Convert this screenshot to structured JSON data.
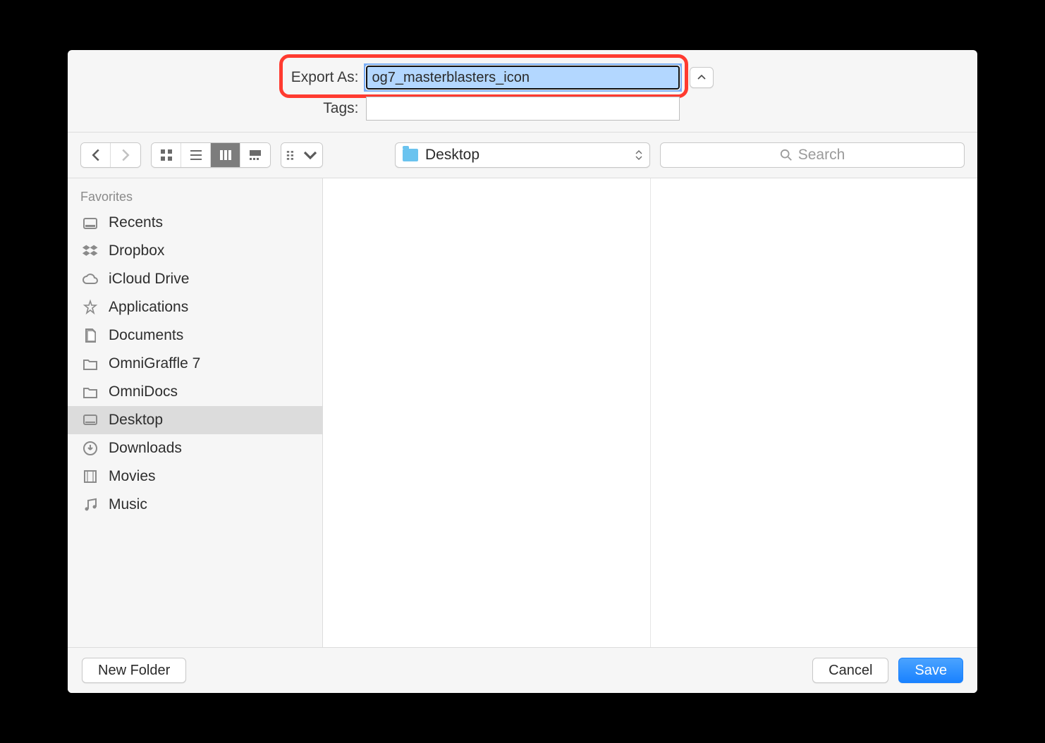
{
  "header": {
    "export_label": "Export As:",
    "export_value": "og7_masterblasters_icon",
    "tags_label": "Tags:",
    "tags_value": ""
  },
  "toolbar": {
    "location_label": "Desktop",
    "search_placeholder": "Search"
  },
  "sidebar": {
    "heading": "Favorites",
    "items": [
      {
        "label": "Recents",
        "icon": "recents-icon",
        "selected": false
      },
      {
        "label": "Dropbox",
        "icon": "dropbox-icon",
        "selected": false
      },
      {
        "label": "iCloud Drive",
        "icon": "cloud-icon",
        "selected": false
      },
      {
        "label": "Applications",
        "icon": "applications-icon",
        "selected": false
      },
      {
        "label": "Documents",
        "icon": "documents-icon",
        "selected": false
      },
      {
        "label": "OmniGraffle 7",
        "icon": "folder-icon",
        "selected": false
      },
      {
        "label": "OmniDocs",
        "icon": "folder-icon",
        "selected": false
      },
      {
        "label": "Desktop",
        "icon": "desktop-icon",
        "selected": true
      },
      {
        "label": "Downloads",
        "icon": "downloads-icon",
        "selected": false
      },
      {
        "label": "Movies",
        "icon": "movies-icon",
        "selected": false
      },
      {
        "label": "Music",
        "icon": "music-icon",
        "selected": false
      }
    ]
  },
  "footer": {
    "new_folder_label": "New Folder",
    "cancel_label": "Cancel",
    "save_label": "Save"
  }
}
